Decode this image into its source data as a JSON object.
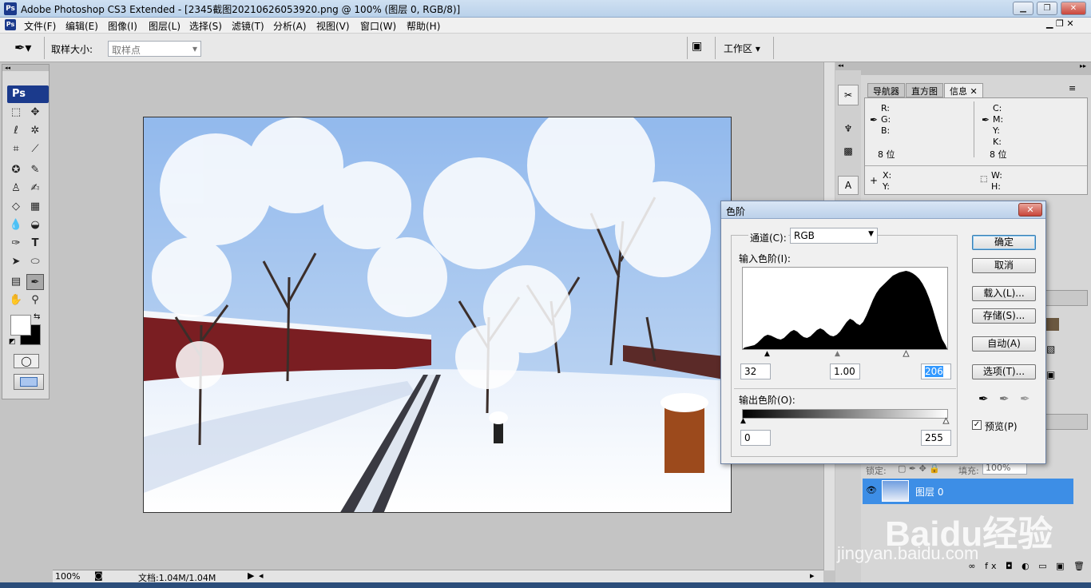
{
  "app": {
    "title": "Adobe Photoshop CS3 Extended - [2345截图20210626053920.png @ 100% (图层 0, RGB/8)]",
    "logo": "Ps"
  },
  "menu": [
    "文件(F)",
    "编辑(E)",
    "图像(I)",
    "图层(L)",
    "选择(S)",
    "滤镜(T)",
    "分析(A)",
    "视图(V)",
    "窗口(W)",
    "帮助(H)"
  ],
  "options": {
    "sample_size_label": "取样大小:",
    "sample_size_value": "取样点",
    "workspace": "工作区 ▾"
  },
  "status": {
    "zoom": "100%",
    "doc": "文档:1.04M/1.04M"
  },
  "info_panel": {
    "tabs": [
      "导航器",
      "直方图",
      "信息"
    ],
    "rgb": [
      "R:",
      "G:",
      "B:"
    ],
    "cmyk": [
      "C:",
      "M:",
      "Y:",
      "K:"
    ],
    "bits_left": "8 位",
    "bits_right": "8 位",
    "x": "X:",
    "y": "Y:",
    "w": "W:",
    "h": "H:"
  },
  "layers_panel": {
    "lock": "锁定:",
    "fill": "填充:",
    "fill_value": "100%",
    "layer_name": "图层 0"
  },
  "watermark": {
    "brand": "Baidu经验",
    "url": "jingyan.baidu.com"
  },
  "levels_dialog": {
    "title": "色阶",
    "channel_label": "通道(C):",
    "channel_value": "RGB",
    "input_label": "输入色阶(I):",
    "input_black": "32",
    "input_gamma": "1.00",
    "input_white": "206",
    "output_label": "输出色阶(O):",
    "output_black": "0",
    "output_white": "255",
    "buttons": {
      "ok": "确定",
      "cancel": "取消",
      "load": "载入(L)...",
      "save": "存储(S)...",
      "auto": "自动(A)",
      "options": "选项(T)..."
    },
    "preview_label": "预览(P)",
    "preview_checked": true,
    "histogram": [
      2,
      3,
      4,
      5,
      8,
      12,
      16,
      18,
      17,
      15,
      13,
      12,
      14,
      18,
      22,
      24,
      22,
      18,
      15,
      14,
      16,
      20,
      24,
      26,
      24,
      20,
      17,
      16,
      18,
      22,
      28,
      34,
      38,
      36,
      32,
      30,
      34,
      42,
      52,
      62,
      70,
      76,
      80,
      84,
      88,
      92,
      94,
      96,
      97,
      98,
      97,
      95,
      92,
      88,
      82,
      74,
      64,
      52,
      38,
      24,
      12,
      5
    ]
  }
}
